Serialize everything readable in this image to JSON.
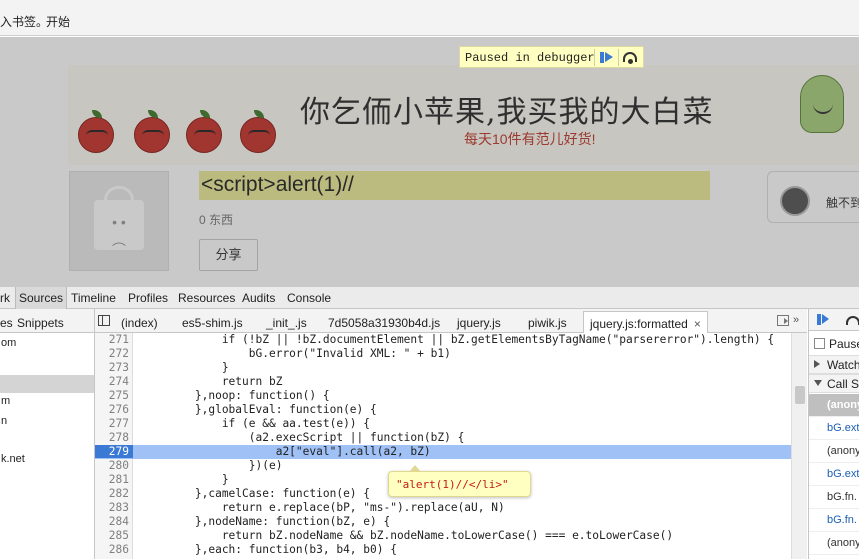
{
  "bookmarks": {
    "partial_label": "入书签。",
    "start_label": "开始"
  },
  "banner": {
    "title": "你乞侕小苹果,我买我的大白菜",
    "subtitle": "每天10件有范儿好货!"
  },
  "debugger_banner": {
    "text": "Paused in debugger"
  },
  "shop": {
    "title": "<script>alert(1)//",
    "item_count": "0 东西",
    "share_label": "分享",
    "user_name": "触不到"
  },
  "devtools": {
    "tabs": [
      "rk",
      "Sources",
      "Timeline",
      "Profiles",
      "Resources",
      "Audits",
      "Console"
    ],
    "active_tab": "Sources",
    "navigator": {
      "tabs": [
        "es",
        "Snippets"
      ],
      "items": [
        "om",
        "",
        "",
        "m",
        "n",
        "",
        "k.net"
      ]
    },
    "file_tabs": [
      "(index)",
      "es5-shim.js",
      "_init_.js",
      "7d5058a31930b4d.js",
      "jquery.js",
      "piwik.js",
      "jquery.js:formatted"
    ],
    "active_file": "jquery.js:formatted",
    "close_symbol": "×",
    "more_symbol": "»",
    "code_lines": [
      {
        "n": "271",
        "text": "            if (!bZ || !bZ.documentElement || bZ.getElementsByTagName(\"parsererror\").length) {"
      },
      {
        "n": "272",
        "text": "                bG.error(\"Invalid XML: \" + b1)"
      },
      {
        "n": "273",
        "text": "            }"
      },
      {
        "n": "274",
        "text": "            return bZ"
      },
      {
        "n": "275",
        "text": "        },noop: function() {"
      },
      {
        "n": "276",
        "text": "        },globalEval: function(e) {"
      },
      {
        "n": "277",
        "text": "            if (e && aa.test(e)) {"
      },
      {
        "n": "278",
        "text": "                (a2.execScript || function(bZ) {"
      },
      {
        "n": "279",
        "text": "                    a2[\"eval\"].call(a2, bZ)"
      },
      {
        "n": "280",
        "text": "                })(e)"
      },
      {
        "n": "281",
        "text": "            }"
      },
      {
        "n": "282",
        "text": "        },camelCase: function(e) {"
      },
      {
        "n": "283",
        "text": "            return e.replace(bP, \"ms-\").replace(aU, N)"
      },
      {
        "n": "284",
        "text": "        },nodeName: function(bZ, e) {"
      },
      {
        "n": "285",
        "text": "            return bZ.nodeName && bZ.nodeName.toLowerCase() === e.toLowerCase()"
      },
      {
        "n": "286",
        "text": "        },each: function(b3, b4, b0) {"
      }
    ],
    "tooltip": "\"alert(1)//</li>\"",
    "sidebar": {
      "pause_label": "Pause",
      "watch_label": "Watch",
      "callstack_label": "Call St",
      "frames": [
        "(anony",
        "bG.ext",
        "(anony",
        "bG.ext",
        "bG.fn.",
        "bG.fn.",
        "(anony"
      ]
    }
  }
}
